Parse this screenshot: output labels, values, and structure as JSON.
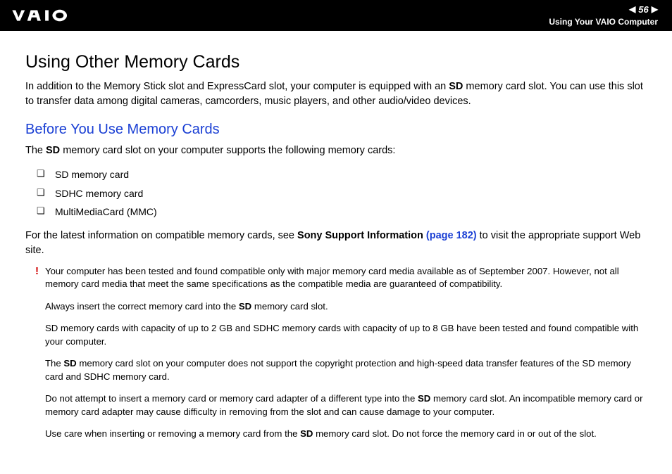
{
  "header": {
    "page_number": "56",
    "section": "Using Your VAIO Computer"
  },
  "title": "Using Other Memory Cards",
  "intro_pre": "In addition to the Memory Stick slot and ExpressCard slot, your computer is equipped with an ",
  "intro_bold": "SD",
  "intro_post": " memory card slot. You can use this slot to transfer data among digital cameras, camcorders, music players, and other audio/video devices.",
  "subtitle": "Before You Use Memory Cards",
  "support_pre": "The ",
  "support_bold": "SD",
  "support_post": " memory card slot on your computer supports the following memory cards:",
  "cards": [
    "SD memory card",
    "SDHC memory card",
    "MultiMediaCard (MMC)"
  ],
  "latest_pre": "For the latest information on compatible memory cards, see ",
  "latest_link_label": "Sony Support Information ",
  "latest_link_page": "(page 182)",
  "latest_post": " to visit the appropriate support Web site.",
  "notes": {
    "n1": "Your computer has been tested and found compatible only with major memory card media available as of September 2007. However, not all memory card media that meet the same specifications as the compatible media are guaranteed of compatibility.",
    "n2_pre": "Always insert the correct memory card into the ",
    "n2_bold": "SD",
    "n2_post": " memory card slot.",
    "n3": "SD memory cards with capacity of up to 2 GB and SDHC memory cards with capacity of up to 8 GB have been tested and found compatible with your computer.",
    "n4_pre": "The ",
    "n4_bold": "SD",
    "n4_post": " memory card slot on your computer does not support the copyright protection and high-speed data transfer features of the SD memory card and SDHC memory card.",
    "n5_pre": "Do not attempt to insert a memory card or memory card adapter of a different type into the ",
    "n5_bold": "SD",
    "n5_post": " memory card slot. An incompatible memory card or memory card adapter may cause difficulty in removing from the slot and can cause damage to your computer.",
    "n6_pre": "Use care when inserting or removing a memory card from the ",
    "n6_bold": "SD",
    "n6_post": " memory card slot. Do not force the memory card in or out of the slot."
  }
}
